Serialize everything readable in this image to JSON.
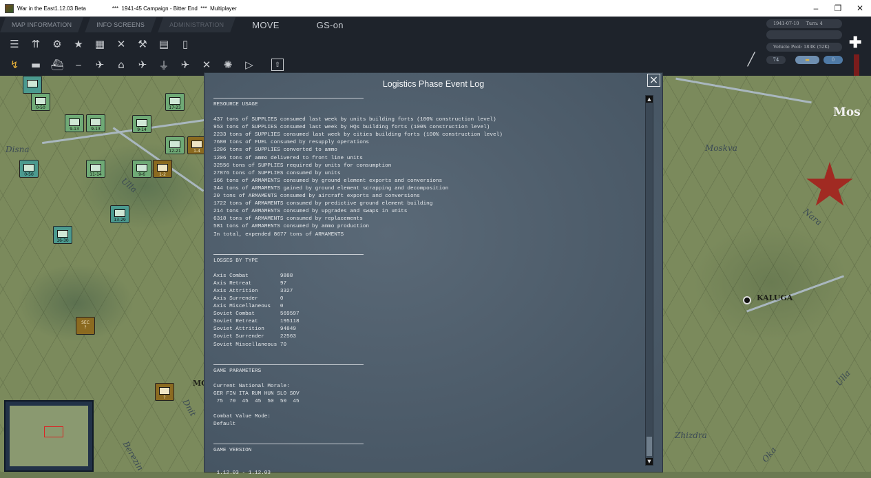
{
  "window": {
    "app_title": "War in the East1.12.03 Beta",
    "subtitle": "***  1941-45 Campaign - Bitter End  ***  Multiplayer",
    "minimize": "–",
    "restore": "❐",
    "close": "✕"
  },
  "menu": {
    "tabs": [
      "MAP INFORMATION",
      "INFO SCREENS",
      "ADMINISTRATION"
    ],
    "mode": "MOVE",
    "gs": "GS-on"
  },
  "status": {
    "date": "1941-07-10",
    "turn": "Turn: 4",
    "vehicle_pool": "Vehicle Pool: 183K (52K)",
    "counter": "74",
    "toggle_value": "0"
  },
  "map": {
    "labels": [
      "Disna",
      "Ulla",
      "Moskva",
      "Nara",
      "Zhizdra",
      "Ulla",
      "Oka",
      "Dnit",
      "Berezin"
    ],
    "cities": [
      "KALUGA",
      "Mos",
      "MC"
    ],
    "counters": [
      "0-50",
      "9-13",
      "0-50",
      "9-13",
      "9-14",
      "17-23",
      "12-21",
      "1-4",
      "0-50",
      "11-14",
      "9-6",
      "1-2",
      "13-29",
      "16-30",
      "SEC",
      "?",
      "?"
    ]
  },
  "dialog": {
    "title": "Logistics Phase Event Log",
    "close": "×",
    "sections": [
      {
        "heading": "RESOURCE USAGE",
        "lines": [
          "437 tons of SUPPLIES consumed last week by units building forts (100% construction level)",
          "953 tons of SUPPLIES consumed last week by HQs building forts (100% construction level)",
          "2233 tons of SUPPLIES consumed last week by cities building forts (100% construction level)",
          "7680 tons of FUEL consumed by resupply operations",
          "1206 tons of SUPPLIES converted to ammo",
          "1206 tons of ammo delivered to front line units",
          "32556 tons of SUPPLIES required by units for consumption",
          "27876 tons of SUPPLIES consumed by units",
          "166 tons of ARMAMENTS consumed by ground element exports and conversions",
          "344 tons of ARMAMENTS gained by ground element scrapping and decomposition",
          "20 tons of ARMAMENTS consumed by aircraft exports and conversions",
          "1722 tons of ARMAMENTS consumed by predictive ground element building",
          "214 tons of ARMAMENTS consumed by upgrades and swaps in units",
          "6318 tons of ARMAMENTS consumed by replacements",
          "581 tons of ARMAMENTS consumed by ammo production",
          "In total, expended 8677 tons of ARMAMENTS"
        ]
      },
      {
        "heading": "LOSSES BY TYPE",
        "lines": [
          "Axis Combat          9888",
          "Axis Retreat         97",
          "Axis Attrition       3327",
          "Axis Surrender       0",
          "Axis Miscellaneous   0",
          "Soviet Combat        569597",
          "Soviet Retreat       195118",
          "Soviet Attrition     94849",
          "Soviet Surrender     22563",
          "Soviet Miscellaneous 70"
        ]
      },
      {
        "heading": "GAME PARAMETERS",
        "lines": [
          "Current National Morale:",
          "GER FIN ITA RUM HUN SLO SOV",
          " 75  70  45  45  50  50  45",
          "",
          "Combat Value Mode:",
          "Default"
        ]
      },
      {
        "heading": "GAME VERSION",
        "lines": [
          "",
          " 1.12.03 - 1.12.03"
        ]
      }
    ]
  }
}
